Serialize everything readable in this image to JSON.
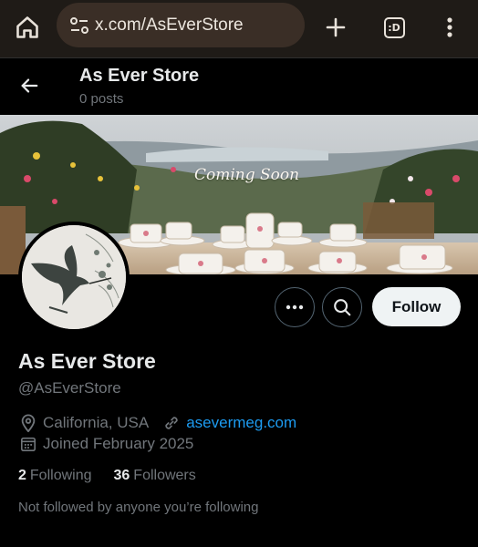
{
  "browser": {
    "url": "x.com/AsEverStore",
    "tab_count_label": ":D"
  },
  "header": {
    "name": "As Ever Store",
    "posts": "0 posts"
  },
  "banner": {
    "overlay_text": "Coming Soon"
  },
  "actions": {
    "follow_label": "Follow"
  },
  "profile": {
    "name": "As Ever Store",
    "handle": "@AsEverStore",
    "location": "California, USA",
    "website": "asevermeg.com",
    "joined": "Joined February 2025",
    "following_count": "2",
    "following_label": "Following",
    "followers_count": "36",
    "followers_label": "Followers",
    "not_followed_text": "Not followed by anyone you’re following"
  },
  "colors": {
    "background": "#000000",
    "link": "#1d9bf0",
    "muted": "#71767b",
    "follow_button": "#eff3f4"
  }
}
